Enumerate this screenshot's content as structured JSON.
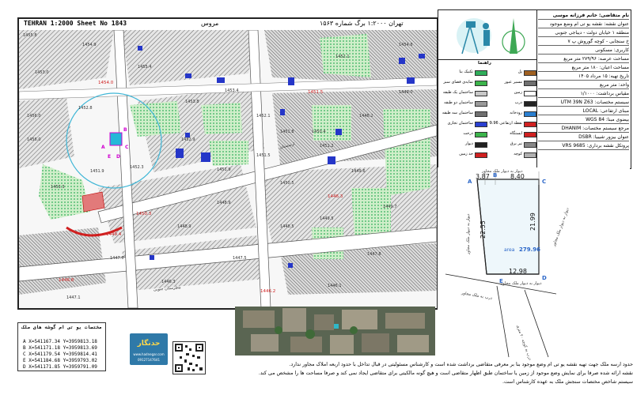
{
  "map": {
    "title_left": "TEHRAN 1:2000 Sheet No 1843",
    "title_mid": "مروس",
    "title_right": "تهران ۱:۲۰۰۰ برگ شماره ۱۵۶۳",
    "red_labels": [
      "1454.0",
      "1451.5",
      "1450.3",
      "1449.4",
      "1446.8",
      "1446.2",
      "1446.3"
    ],
    "grey_labels": [
      "1455.8",
      "1454.9",
      "1455.4",
      "1453.0",
      "1452.8",
      "1456.0",
      "1452.3",
      "1453.8",
      "1453.4",
      "1451.9",
      "1452.9",
      "1451.9",
      "1453.3",
      "1452.1",
      "1451.5",
      "1450.5",
      "1449.6",
      "1448.9",
      "1449.5",
      "1449.7",
      "1448.9",
      "1448.5",
      "1447.6",
      "1447.5",
      "1447.8",
      "1446.3",
      "1446.1",
      "1448.2",
      "1449.0",
      "1447.1",
      "1450.4",
      "1451.2",
      "1451.8",
      "1452.1",
      "1454.8",
      "1456.0"
    ],
    "site_label": "A",
    "circle_letters": [
      "B",
      "C",
      "D",
      "E"
    ],
    "street_label": "مطرستان جنوبی",
    "street_label_2": "ارمنستان",
    "footnote": "sheet"
  },
  "legend": {
    "title": "راهنما",
    "items": [
      {
        "label": "تکنیک بنا",
        "color": "#2fae5a"
      },
      {
        "label": "نمایه‌ی فضای سبز",
        "color": "#3cb44b"
      },
      {
        "label": "ساختمان یک طبقه",
        "color": "#c8c8c8"
      },
      {
        "label": "ساختمان دو طبقه",
        "color": "#9a9a9a"
      },
      {
        "label": "ساختمان سه طبقه",
        "color": "#707070"
      },
      {
        "label": "ساختمان تجاری",
        "color": "#2a3fd0"
      },
      {
        "label": "درخت",
        "color": "#3cb44b"
      },
      {
        "label": "دیوار",
        "color": "#222222"
      },
      {
        "label": "حد زمین",
        "color": "#d02020"
      },
      {
        "label": "پل",
        "color": "#a06020"
      },
      {
        "label": "مسیر عبور",
        "color": "#707070"
      },
      {
        "label": "زمین",
        "color": "#ffffff"
      },
      {
        "label": "درب",
        "color": "#222222"
      },
      {
        "label": "رودخانه",
        "color": "#2a7fd0"
      },
      {
        "label": "نقطه ارتفاعی 99.96",
        "color": "#d02020"
      },
      {
        "label": "ایستگاه",
        "color": "#d02020"
      },
      {
        "label": "تیر برق",
        "color": "#888888"
      },
      {
        "label": "کوچه",
        "color": "#b0b0b0"
      }
    ]
  },
  "info": {
    "rows": [
      "نام متقاضی: خانم فرزانه موسی",
      "عنوان نقشه: نقشه یو تی ام وضع موجود",
      "منطقه ۱ خیابان دولت - دیباجی جنوبی",
      "خ سنجابی - کوچه گوروش پ ۷",
      "کاربری: مسکونی",
      "مساحت عرصه: ۲۷۹/۹۶ متر مربع",
      "مساحت اعیان: ۱۸۰ متر مربع",
      "تاریخ تهیه: ۱۵ مرداد ۱۴۰۵",
      "واحد: متر مربع",
      "مقیاس برداشت: ۱/۱۰۰۰",
      "سیستم مختصات: UTM 39N Z63",
      "مبنای ارتفاعی: LOCAL",
      "بیضوی مبنا: WGS 84",
      "مرجع سیستم مختصات: DHANIM",
      "عنوان بیزور شیبیا: DSBR",
      "پروتکل نقشه برداری: VRS 9685"
    ]
  },
  "parcel": {
    "top_left": "3.87",
    "top_right": "8.40",
    "left_side": "22.55",
    "right_side": "21.99",
    "bottom": "12.98",
    "area_label": "area",
    "area_value": "279.96",
    "corner_a": "A",
    "corner_b": "B",
    "corner_c": "C",
    "corner_d": "D",
    "corner_e": "E",
    "top_caption": "دیوار به دیوار ملک مجاور",
    "left_caption": "دیوار به دیوار ملک مجاور",
    "right_caption": "دیوار به دیوار ملک مجاور",
    "bottom_caption": "دیوار به دیوار ملک مجاور",
    "lower_caption_1": "درب به ملک مجاور",
    "lower_caption_2": "درب به کوچه ۲۰ متری"
  },
  "coords": {
    "title": "مختصات یو تی ام گوشه های ملک",
    "lines": [
      "A X=541167.34  Y=3959813.18",
      "B X=541171.18  Y=3959813.69",
      "C X=541179.54  Y=3959814.41",
      "E X=541184.68  Y=3959793.02",
      "D X=541171.85  Y=3959791.09"
    ]
  },
  "brand": {
    "name": "حدنگار",
    "sub": "www.hadnegar.com",
    "phone": "09127147641"
  },
  "footer": {
    "line1": "حدود ارسه ملک جهت تهیه نقشه یو تی ام وضع موجود بنا بر معرفی متقاضی برداشت شده است و کارشناس مسئولیتی در قبال تداخل با حدود اربعه املاک مجاور ندارد.",
    "line2": "نقشه ارائه شده صرفا برای نمایش وضع موجود از زمین یا ساختمان طبق اظهار متقاضی است و هیچ گونه مالکیتی برای متقاضی ایجاد نمی کند و صرفا مساحت ها را مشخص می کند.",
    "line3": "سیستم شاخص مختصات سنجش ملک به عهده کارشناس است."
  }
}
